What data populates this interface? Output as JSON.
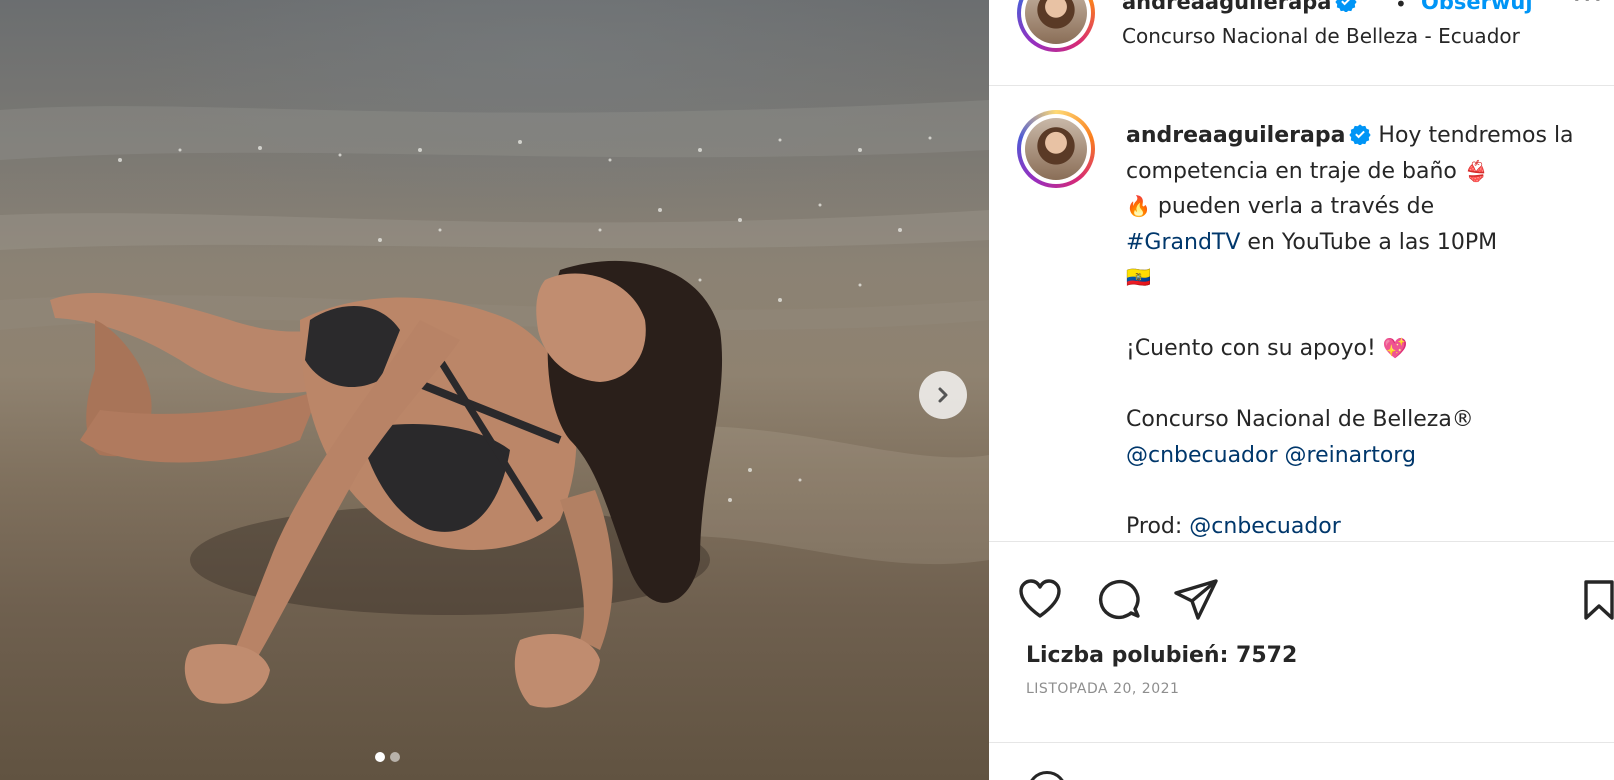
{
  "post": {
    "username": "andreaaguilerapa",
    "follow_label": "Obserwuj",
    "separator": "•",
    "location": "Concurso Nacional de Belleza - Ecuador",
    "more_label": "···"
  },
  "caption": {
    "username": "andreaaguilerapa",
    "line1": "Hoy tendremos la competencia en traje de baño",
    "emoji_swimsuit": "👙",
    "emoji_fire": "🔥",
    "line2": "pueden verla a través de",
    "hashtag": "#GrandTV",
    "line3": "en YouTube a las 10PM",
    "emoji_flag": "🇪🇨",
    "support": "¡Cuento con su apoyo!",
    "emoji_heart": "💖",
    "org": "Concurso Nacional de Belleza®",
    "mention1": "@cnbecuador",
    "mention2": "@reinartorg",
    "prod_label": "Prod:",
    "prod_mention": "@cnbecuador"
  },
  "stats": {
    "likes": "Liczba polubień: 7572",
    "date": "LISTOPADA 20, 2021"
  },
  "icons": {
    "like": "heart-icon",
    "comment": "comment-icon",
    "share": "share-icon",
    "save": "bookmark-icon",
    "next": "chevron-right-icon"
  },
  "colors": {
    "accent": "#0095f6",
    "link": "#00376b",
    "text": "#262626",
    "muted": "#8e8e8e"
  },
  "carousel": {
    "total": 2,
    "current": 1
  }
}
